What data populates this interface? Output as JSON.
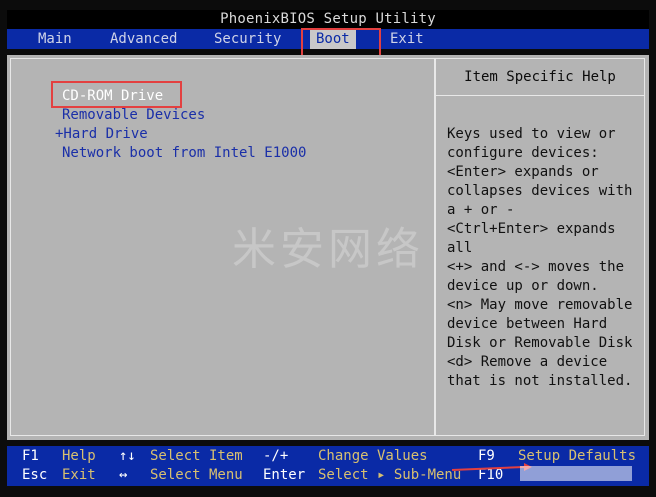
{
  "title": "PhoenixBIOS Setup Utility",
  "menu": [
    {
      "label": "Main"
    },
    {
      "label": "Advanced"
    },
    {
      "label": "Security"
    },
    {
      "label": "Boot"
    },
    {
      "label": "Exit"
    }
  ],
  "active_menu": "Boot",
  "boot_items": [
    {
      "label": "CD-ROM Drive"
    },
    {
      "label": "Removable Devices"
    },
    {
      "label": "+Hard Drive"
    },
    {
      "label": "Network boot from Intel E1000"
    }
  ],
  "selected_boot_item": "CD-ROM Drive",
  "help": {
    "title": "Item Specific Help",
    "lines": [
      "Keys used to view or",
      "configure devices:",
      "<Enter> expands or",
      "collapses devices with",
      "a + or -",
      "<Ctrl+Enter> expands",
      "all",
      "<+> and <-> moves the",
      "device up or down.",
      "<n> May move removable",
      "device between Hard",
      "Disk or Removable Disk",
      "<d> Remove a device",
      "that is not installed."
    ]
  },
  "keys": {
    "row1": [
      {
        "key": "F1",
        "desc": "Help"
      },
      {
        "key": "↑↓",
        "desc": "Select Item"
      },
      {
        "key": "-/+",
        "desc": "Change Values"
      },
      {
        "key": "F9",
        "desc": "Setup Defaults"
      }
    ],
    "row2": [
      {
        "key": "Esc",
        "desc": "Exit"
      },
      {
        "key": "↔",
        "desc": "Select Menu"
      },
      {
        "key": "Enter",
        "desc": "Select ▸ Sub-Menu"
      },
      {
        "key": "F10",
        "desc": ""
      }
    ]
  },
  "watermark_text": "米安网络",
  "colors": {
    "menubar": "#0a2aa6",
    "panel": "#b4b4b4",
    "item_text": "#1a2fa8",
    "key_desc": "#d8c070",
    "highlight": "#e34040"
  }
}
